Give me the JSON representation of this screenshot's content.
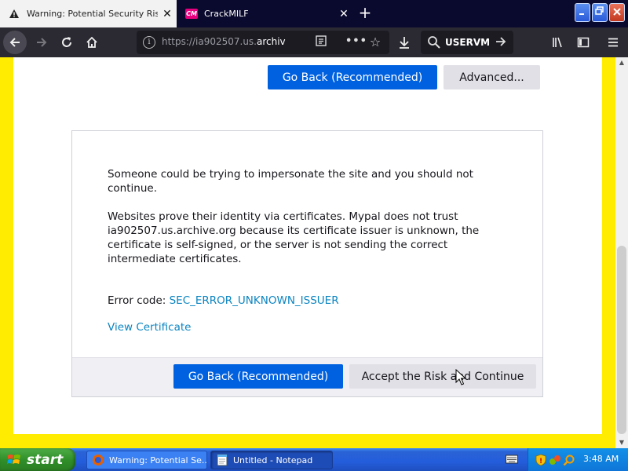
{
  "browser": {
    "tabs": [
      {
        "title": "Warning: Potential Security Risk Ahead",
        "active": true,
        "icon": "warning-icon"
      },
      {
        "title": "CrackMILF",
        "active": false,
        "icon": "crackmilf-favicon",
        "favicon_text": "CM"
      }
    ],
    "close_glyph": "✕",
    "new_tab_glyph": "+",
    "url": {
      "prefix": "https://ia902507.us.",
      "domain": "archive"
    },
    "search": {
      "text": "USERVM"
    },
    "accent": "#0061e0"
  },
  "page": {
    "background": "#ffec00",
    "top_buttons": {
      "go_back": "Go Back (Recommended)",
      "advanced": "Advanced..."
    },
    "paragraphs": [
      "Someone could be trying to impersonate the site and you should not continue.",
      "Websites prove their identity via certificates. Mypal does not trust ia902507.us.archive.org because its certificate issuer is unknown, the certificate is self-signed, or the server is not sending the correct intermediate certificates."
    ],
    "error_label": "Error code:",
    "error_code": "SEC_ERROR_UNKNOWN_ISSUER",
    "view_certificate": "View Certificate",
    "bottom_buttons": {
      "go_back": "Go Back (Recommended)",
      "accept": "Accept the Risk and Continue"
    }
  },
  "taskbar": {
    "start_label": "start",
    "tasks": [
      {
        "label": "Warning: Potential Se...",
        "icon": "firefox-icon",
        "active": false
      },
      {
        "label": "Untitled - Notepad",
        "icon": "notepad-icon",
        "active": true
      }
    ],
    "clock": "3:48 AM"
  }
}
